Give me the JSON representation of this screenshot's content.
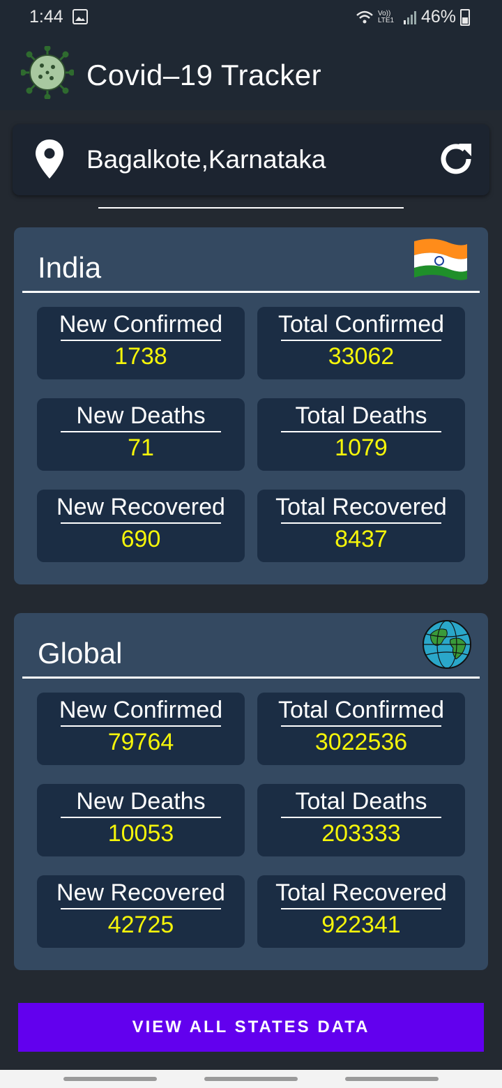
{
  "status_bar": {
    "time": "1:44",
    "battery": "46%",
    "network_label": "Vo)) LTE1"
  },
  "app_bar": {
    "title": "Covid–19 Tracker"
  },
  "location": {
    "name": "Bagalkote,Karnataka"
  },
  "india": {
    "title": "India",
    "stats": {
      "new_confirmed": {
        "label": "New Confirmed",
        "value": "1738"
      },
      "total_confirmed": {
        "label": "Total Confirmed",
        "value": "33062"
      },
      "new_deaths": {
        "label": "New Deaths",
        "value": "71"
      },
      "total_deaths": {
        "label": "Total Deaths",
        "value": "1079"
      },
      "new_recovered": {
        "label": "New Recovered",
        "value": "690"
      },
      "total_recovered": {
        "label": "Total Recovered",
        "value": "8437"
      }
    }
  },
  "global": {
    "title": "Global",
    "stats": {
      "new_confirmed": {
        "label": "New Confirmed",
        "value": "79764"
      },
      "total_confirmed": {
        "label": "Total Confirmed",
        "value": "3022536"
      },
      "new_deaths": {
        "label": "New Deaths",
        "value": "10053"
      },
      "total_deaths": {
        "label": "Total Deaths",
        "value": "203333"
      },
      "new_recovered": {
        "label": "New Recovered",
        "value": "42725"
      },
      "total_recovered": {
        "label": "Total Recovered",
        "value": "922341"
      }
    }
  },
  "button": {
    "label": "VIEW ALL STATES DATA"
  },
  "icons": {
    "logo": "virus-logo-icon",
    "location": "location-pin-icon",
    "refresh": "refresh-icon",
    "india": "india-flag-icon",
    "global": "globe-icon"
  },
  "colors": {
    "background": "#232931",
    "panel": "#344961",
    "card": "#1b2d44",
    "value": "#f5f50a",
    "button": "#6200ee"
  }
}
